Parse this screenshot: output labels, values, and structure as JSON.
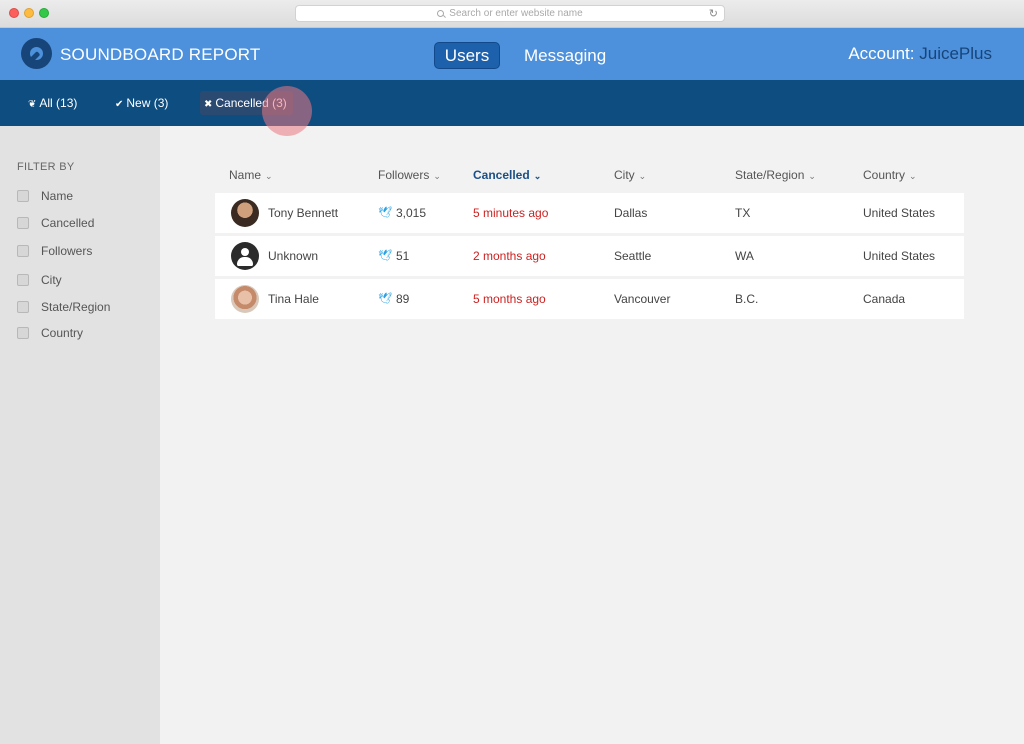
{
  "browser": {
    "search_placeholder": "Search or enter website name",
    "reload_icon": "reload-icon"
  },
  "header": {
    "brand": "SOUNDBOARD REPORT",
    "nav": {
      "users": "Users",
      "messaging": "Messaging"
    },
    "account_label": "Account:",
    "account_name": "JuicePlus"
  },
  "subnav": {
    "all": "All (13)",
    "new": "New (3)",
    "cancelled": "Cancelled (3)"
  },
  "sidebar": {
    "title": "FILTER BY",
    "filters": [
      "Name",
      "Cancelled",
      "Followers",
      "City",
      "State/Region",
      "Country"
    ]
  },
  "table": {
    "columns": [
      "Name",
      "Followers",
      "Cancelled",
      "City",
      "State/Region",
      "Country"
    ],
    "active_column": "Cancelled",
    "rows": [
      {
        "name": "Tony Bennett",
        "followers": "3,015",
        "cancelled": "5 minutes ago",
        "city": "Dallas",
        "state": "TX",
        "country": "United States"
      },
      {
        "name": "Unknown",
        "followers": "51",
        "cancelled": "2 months ago",
        "city": "Seattle",
        "state": "WA",
        "country": "United States"
      },
      {
        "name": "Tina Hale",
        "followers": "89",
        "cancelled": "5 months ago",
        "city": "Vancouver",
        "state": "B.C.",
        "country": "Canada"
      }
    ]
  },
  "colors": {
    "header_bg": "#4d90dc",
    "subnav_bg": "#0e4d80",
    "accent_dark": "#17457a",
    "cancelled_red": "#cc2222",
    "twitter_blue": "#2aa3e6"
  }
}
